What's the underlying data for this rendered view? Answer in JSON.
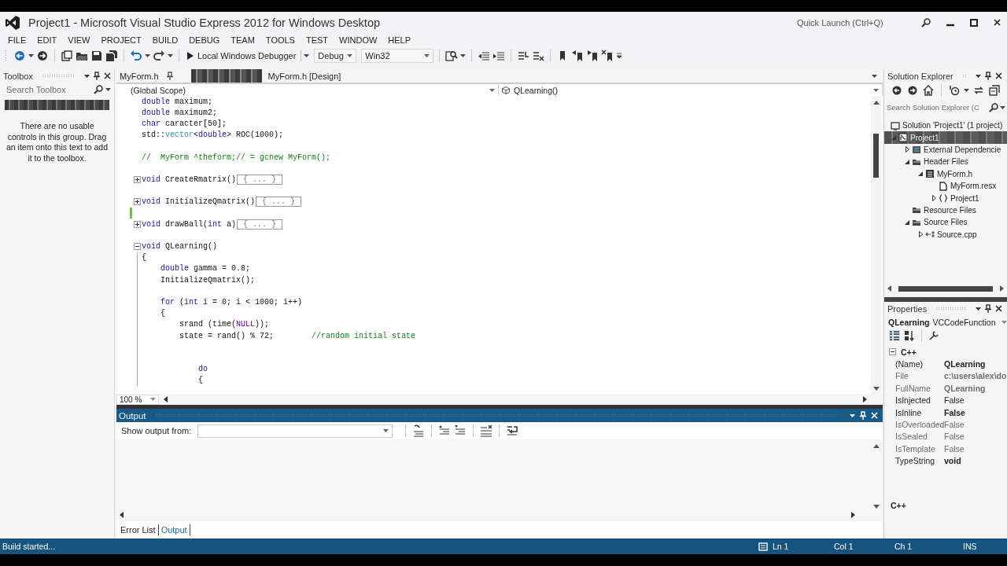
{
  "window": {
    "title": "Project1 - Microsoft Visual Studio Express 2012 for Windows Desktop",
    "quick_launch": {
      "placeholder": "Quick Launch (Ctrl+Q)"
    }
  },
  "menu": [
    "FILE",
    "EDIT",
    "VIEW",
    "PROJECT",
    "BUILD",
    "DEBUG",
    "TEAM",
    "TOOLS",
    "TEST",
    "WINDOW",
    "HELP"
  ],
  "toolbar": {
    "debugger": "Local Windows Debugger",
    "configuration": "Debug",
    "platform": "Win32"
  },
  "toolbox": {
    "title": "Toolbox",
    "search": {
      "placeholder": "Search Toolbox"
    },
    "message": "There are no usable controls in this group. Drag an item onto this text to add it to the toolbox."
  },
  "document_tabs": [
    {
      "label": "MyForm.h",
      "kind": "pinned"
    },
    {
      "kind": "obscured"
    },
    {
      "label": "MyForm.h [Design]",
      "kind": "plain"
    }
  ],
  "editor": {
    "scope": "(Global Scope)",
    "member": "QLearning()",
    "zoom": "100 %",
    "lines": [
      {
        "kind": "code",
        "tokens": [
          {
            "text": "double",
            "kind": "kw"
          },
          {
            "text": " maximum;",
            "kind": "plain"
          }
        ]
      },
      {
        "kind": "code",
        "tokens": [
          {
            "text": "double",
            "kind": "kw"
          },
          {
            "text": " maximum2;",
            "kind": "plain"
          }
        ]
      },
      {
        "kind": "code",
        "tokens": [
          {
            "text": "char",
            "kind": "kw"
          },
          {
            "text": " caracter[50];",
            "kind": "plain"
          }
        ]
      },
      {
        "kind": "code",
        "tokens": [
          {
            "text": "std::",
            "kind": "plain"
          },
          {
            "text": "vector",
            "kind": "type"
          },
          {
            "text": "<",
            "kind": "plain"
          },
          {
            "text": "double",
            "kind": "kw"
          },
          {
            "text": "> ROC(1000);",
            "kind": "plain"
          }
        ]
      },
      {
        "kind": "blank"
      },
      {
        "kind": "code",
        "tokens": [
          {
            "text": "//  MyForm ^theform;// = gcnew MyForm();",
            "kind": "comment"
          }
        ]
      },
      {
        "kind": "blank"
      },
      {
        "kind": "collapsed",
        "tokens": [
          {
            "text": "void",
            "kind": "kw"
          },
          {
            "text": " CreateRmatrix()",
            "kind": "plain"
          }
        ],
        "folded": "{ ... }"
      },
      {
        "kind": "blank"
      },
      {
        "kind": "collapsed",
        "tokens": [
          {
            "text": "void",
            "kind": "kw"
          },
          {
            "text": " InitializeQmatrix()",
            "kind": "plain"
          }
        ],
        "folded": "{ ... }"
      },
      {
        "kind": "changed"
      },
      {
        "kind": "collapsed",
        "tokens": [
          {
            "text": "void",
            "kind": "kw"
          },
          {
            "text": " drawBall(",
            "kind": "plain"
          },
          {
            "text": "int",
            "kind": "kw"
          },
          {
            "text": " a)",
            "kind": "plain"
          }
        ],
        "folded": "{ ... }"
      },
      {
        "kind": "blank"
      },
      {
        "kind": "expanded",
        "tokens": [
          {
            "text": "void",
            "kind": "kw"
          },
          {
            "text": " QLearning()",
            "kind": "plain"
          }
        ]
      },
      {
        "kind": "code",
        "tokens": [
          {
            "text": "{",
            "kind": "plain"
          }
        ]
      },
      {
        "kind": "code",
        "tokens": [
          {
            "text": "    double",
            "kind": "kw"
          },
          {
            "text": " gamma = 0.8;",
            "kind": "plain"
          }
        ]
      },
      {
        "kind": "code",
        "tokens": [
          {
            "text": "    InitializeQmatrix();",
            "kind": "plain"
          }
        ]
      },
      {
        "kind": "blank"
      },
      {
        "kind": "code",
        "tokens": [
          {
            "text": "    for",
            "kind": "kw"
          },
          {
            "text": " (",
            "kind": "plain"
          },
          {
            "text": "int",
            "kind": "kw"
          },
          {
            "text": " i = 0; i < 1000; i++)",
            "kind": "plain"
          }
        ]
      },
      {
        "kind": "code",
        "tokens": [
          {
            "text": "    {",
            "kind": "plain"
          }
        ]
      },
      {
        "kind": "code",
        "tokens": [
          {
            "text": "        srand (time(",
            "kind": "plain"
          },
          {
            "text": "NULL",
            "kind": "macro"
          },
          {
            "text": "));",
            "kind": "plain"
          }
        ]
      },
      {
        "kind": "code",
        "tokens": [
          {
            "text": "        state = rand() % 72;        ",
            "kind": "plain"
          },
          {
            "text": "//random initial state",
            "kind": "comment"
          }
        ]
      },
      {
        "kind": "blank"
      },
      {
        "kind": "blank"
      },
      {
        "kind": "code",
        "tokens": [
          {
            "text": "            do",
            "kind": "kw"
          }
        ]
      },
      {
        "kind": "code",
        "tokens": [
          {
            "text": "            {",
            "kind": "plain"
          }
        ]
      }
    ]
  },
  "output": {
    "title": "Output",
    "source_label": "Show output from:"
  },
  "bottom_tabs": [
    {
      "label": "Error List",
      "selected": false
    },
    {
      "label": "Output",
      "selected": true
    }
  ],
  "solution_explorer": {
    "title": "Solution Explorer",
    "search": {
      "placeholder": "Search Solution Explorer (C"
    },
    "tree": [
      {
        "label": "Solution 'Project1' (1 project)",
        "kind": "solution",
        "selected": false,
        "children": [
          {
            "label": "Project1",
            "kind": "project",
            "expanded": true,
            "selected": true,
            "children": [
              {
                "label": "External Dependencie",
                "kind": "references",
                "expanded": false,
                "selected": false
              },
              {
                "label": "Header Files",
                "kind": "folder",
                "expanded": true,
                "selected": false,
                "children": [
                  {
                    "label": "MyForm.h",
                    "kind": "form",
                    "expanded": true,
                    "selected": false,
                    "children": [
                      {
                        "label": "MyForm.resx",
                        "kind": "resource",
                        "selected": false
                      },
                      {
                        "label": "Project1",
                        "kind": "namespace",
                        "expanded": false,
                        "selected": false
                      }
                    ]
                  }
                ]
              },
              {
                "label": "Resource Files",
                "kind": "folder",
                "selected": false
              },
              {
                "label": "Source Files",
                "kind": "folder",
                "expanded": true,
                "selected": false,
                "children": [
                  {
                    "label": "Source.cpp",
                    "kind": "source",
                    "expanded": false,
                    "selected": false
                  }
                ]
              }
            ]
          }
        ]
      }
    ]
  },
  "properties": {
    "title": "Properties",
    "object_name": "QLearning",
    "object_type": "VCCodeFunction",
    "category": {
      "label": "C++",
      "expanded": true
    },
    "rows": [
      {
        "name": "(Name)",
        "value": "QLearning",
        "readonly": false,
        "modified": true
      },
      {
        "name": "File",
        "value": "c:\\users\\alex\\do",
        "readonly": true,
        "modified": true
      },
      {
        "name": "FullName",
        "value": "QLearning",
        "readonly": true,
        "modified": true
      },
      {
        "name": "IsInjected",
        "value": "False",
        "readonly": false,
        "modified": false
      },
      {
        "name": "IsInline",
        "value": "False",
        "readonly": false,
        "modified": true
      },
      {
        "name": "IsOverloaded",
        "value": "False",
        "readonly": true,
        "modified": false
      },
      {
        "name": "IsSealed",
        "value": "False",
        "readonly": true,
        "modified": false
      },
      {
        "name": "IsTemplate",
        "value": "False",
        "readonly": true,
        "modified": false
      },
      {
        "name": "TypeString",
        "value": "void",
        "readonly": false,
        "modified": true
      }
    ],
    "description": "C++"
  },
  "status_bar": {
    "message": "Build started...",
    "line": "Ln 1",
    "column": "Col 1",
    "char": "Ch 1",
    "mode": "INS"
  }
}
